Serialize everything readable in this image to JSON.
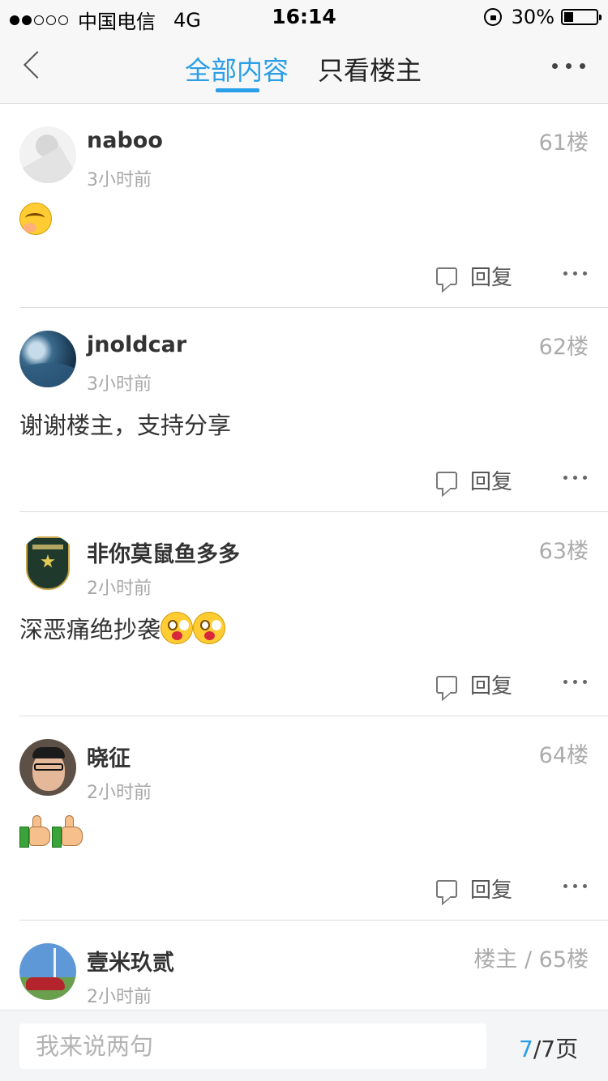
{
  "status_bar": {
    "carrier": "中国电信",
    "network": "4G",
    "time": "16:14",
    "battery_percent_label": "30%",
    "battery_level": 0.3,
    "signal_filled": 2,
    "signal_total": 5
  },
  "nav": {
    "tabs": [
      {
        "label": "全部内容",
        "active": true
      },
      {
        "label": "只看楼主",
        "active": false
      }
    ]
  },
  "posts": [
    {
      "username": "naboo",
      "time": "3小时前",
      "floor": "61楼",
      "content_text": "",
      "emoji": [
        "smile-blush"
      ],
      "reply_label": "回复"
    },
    {
      "username": "jnoldcar",
      "time": "3小时前",
      "floor": "62楼",
      "content_text": "谢谢楼主，支持分享",
      "emoji": [],
      "reply_label": "回复"
    },
    {
      "username": "非你莫鼠鱼多多",
      "time": "2小时前",
      "floor": "63楼",
      "content_text": "深恶痛绝抄袭",
      "emoji": [
        "shocked-face",
        "shocked-face"
      ],
      "reply_label": "回复"
    },
    {
      "username": "晓征",
      "time": "2小时前",
      "floor": "64楼",
      "content_text": "",
      "emoji": [
        "thumbs-up",
        "thumbs-up"
      ],
      "reply_label": "回复"
    },
    {
      "username": "壹米玖贰",
      "time": "2小时前",
      "floor": "楼主 / 65楼",
      "content_text": "",
      "emoji": [],
      "reply_label": ""
    }
  ],
  "bottom": {
    "input_placeholder": "我来说两句",
    "page_current": "7",
    "page_total": "/7页"
  },
  "colors": {
    "accent": "#2a9ee6",
    "muted_text": "#a8a8a8"
  }
}
